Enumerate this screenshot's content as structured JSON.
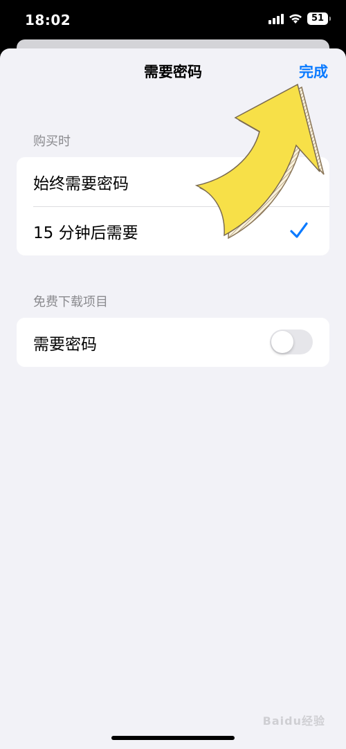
{
  "status_bar": {
    "time": "18:02",
    "battery_level": "51",
    "signal_icon": "cellular-signal-icon",
    "wifi_icon": "wifi-icon",
    "battery_icon": "battery-icon"
  },
  "nav": {
    "title": "需要密码",
    "done_label": "完成"
  },
  "purchase_section": {
    "header": "购买时",
    "options": [
      {
        "label": "始终需要密码",
        "selected": false
      },
      {
        "label": "15 分钟后需要",
        "selected": true
      }
    ]
  },
  "free_downloads_section": {
    "header": "免费下载项目",
    "require_password_label": "需要密码",
    "require_password_enabled": false
  },
  "watermark": "Baidu经验",
  "colors": {
    "accent": "#0a7aff",
    "background": "#f2f2f7",
    "arrow_fill": "#f7e048"
  }
}
